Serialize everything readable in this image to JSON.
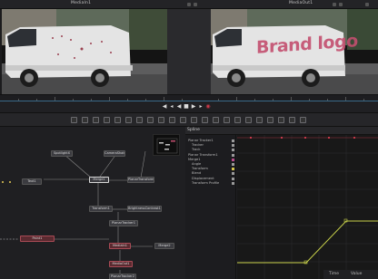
{
  "viewers": {
    "left_title": "MediaIn1",
    "right_title": "MediaOut1",
    "overlay_text": "Brand logo"
  },
  "spline": {
    "title": "Spline",
    "items": [
      {
        "label": "Planar Tracker1",
        "color": "#9a9a9a"
      },
      {
        "label": "Tracker",
        "color": "#9a9a9a"
      },
      {
        "label": "Track",
        "color": "#9a9a9a"
      },
      {
        "label": "Planar Transform1",
        "color": "#9a9a9a"
      },
      {
        "label": "Merge1",
        "color": "#b94a8a"
      },
      {
        "label": "Angle",
        "color": "#9a9a9a"
      },
      {
        "label": "Transform",
        "color": "#d4c24a"
      },
      {
        "label": "Blend",
        "color": "#9a9a9a"
      },
      {
        "label": "Displacement",
        "color": "#9a9a9a"
      },
      {
        "label": "Transform Profile",
        "color": "#9a9a9a"
      }
    ]
  },
  "nodes": [
    {
      "label": "Text1",
      "variant": "normal"
    },
    {
      "label": "SpotlightX",
      "variant": "normal"
    },
    {
      "label": "CameraShake",
      "variant": "normal"
    },
    {
      "label": "Merge1",
      "variant": "selected"
    },
    {
      "label": "PlanarTransform1",
      "variant": "normal"
    },
    {
      "label": "Transform1",
      "variant": "normal"
    },
    {
      "label": "BrightnessContrast1",
      "variant": "normal"
    },
    {
      "label": "PlanarTracker1",
      "variant": "normal"
    },
    {
      "label": "Paint1",
      "variant": "red"
    },
    {
      "label": "MediaIn1",
      "variant": "red"
    },
    {
      "label": "Merge2",
      "variant": "normal"
    },
    {
      "label": "MediaOut1",
      "variant": "red"
    },
    {
      "label": "PlanarTracker2",
      "variant": "normal"
    }
  ],
  "status": {
    "time_label": "Time",
    "value_label": "Value"
  },
  "colors": {
    "accent": "#c34f6f",
    "curve": "#c7d04a",
    "playhead": "#d03a4a"
  }
}
